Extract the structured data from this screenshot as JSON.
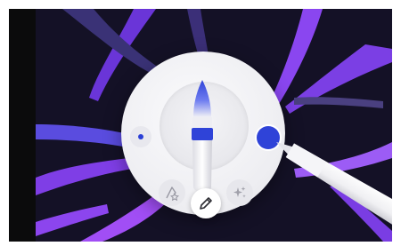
{
  "palette": {
    "active_tool": "pencil",
    "tools": [
      {
        "icon": "shape-pen-icon"
      },
      {
        "icon": "pencil-icon"
      },
      {
        "icon": "sparkle-icon"
      }
    ],
    "selected_color": "#2f43d8",
    "brush_icon": "paintbrush-icon",
    "size_icon": "small-dot-icon"
  },
  "colors": {
    "canvas": "#141126",
    "stroke_purple": "#7b3fe4",
    "accent_blue": "#2f43d8"
  }
}
